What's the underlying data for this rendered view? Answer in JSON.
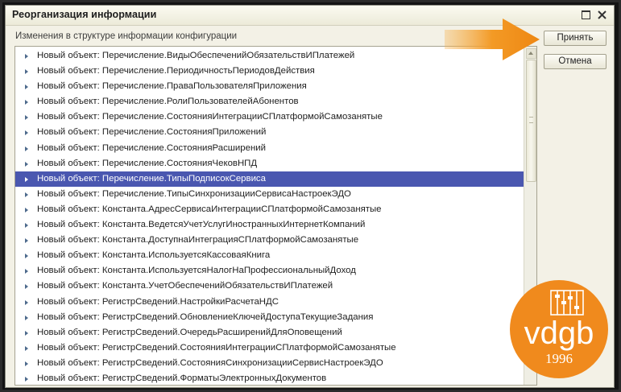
{
  "window": {
    "title": "Реорганизация информации"
  },
  "subheader": "Изменения в структуре информации конфигурации",
  "buttons": {
    "accept": "Принять",
    "cancel": "Отмена"
  },
  "list": {
    "selected_index": 8,
    "items": [
      "Новый объект: Перечисление.ВидыОбеспеченийОбязательствИПлатежей",
      "Новый объект: Перечисление.ПериодичностьПериодовДействия",
      "Новый объект: Перечисление.ПраваПользователяПриложения",
      "Новый объект: Перечисление.РолиПользователейАбонентов",
      "Новый объект: Перечисление.СостоянияИнтеграцииСПлатформойСамозанятые",
      "Новый объект: Перечисление.СостоянияПриложений",
      "Новый объект: Перечисление.СостоянияРасширений",
      "Новый объект: Перечисление.СостоянияЧековНПД",
      "Новый объект: Перечисление.ТипыПодписокСервиса",
      "Новый объект: Перечисление.ТипыСинхронизацииСервисаНастроекЭДО",
      "Новый объект: Константа.АдресСервисаИнтеграцииСПлатформойСамозанятые",
      "Новый объект: Константа.ВедетсяУчетУслугИностранныхИнтернетКомпаний",
      "Новый объект: Константа.ДоступнаИнтеграцияСПлатформойСамозанятые",
      "Новый объект: Константа.ИспользуетсяКассоваяКнига",
      "Новый объект: Константа.ИспользуетсяНалогНаПрофессиональныйДоход",
      "Новый объект: Константа.УчетОбеспеченийОбязательствИПлатежей",
      "Новый объект: РегистрСведений.НастройкиРасчетаНДС",
      "Новый объект: РегистрСведений.ОбновлениеКлючейДоступаТекущиеЗадания",
      "Новый объект: РегистрСведений.ОчередьРасширенийДляОповещений",
      "Новый объект: РегистрСведений.СостоянияИнтеграцииСПлатформойСамозанятые",
      "Новый объект: РегистрСведений.СостоянияСинхронизацииСервисНастроекЭДО",
      "Новый объект: РегистрСведений.ФорматыЭлектронныхДокументов"
    ]
  },
  "logo": {
    "brand": "vdgb",
    "year": "1996"
  },
  "colors": {
    "selection": "#4a57b0",
    "accent_orange": "#f08a1d",
    "window_bg": "#f3f1e6"
  }
}
